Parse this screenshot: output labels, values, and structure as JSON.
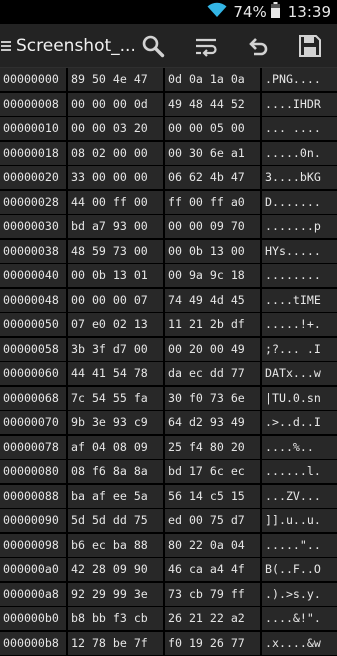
{
  "status_bar": {
    "battery": "74%",
    "time": "13:39",
    "icons": [
      "wifi-icon",
      "battery-icon"
    ]
  },
  "action_bar": {
    "title": "Screenshot_...",
    "actions": [
      "search-icon",
      "wrap-lines-icon",
      "undo-icon",
      "save-icon"
    ]
  },
  "hex_rows": [
    {
      "offset": "00000000",
      "hex1": "89 50 4e 47",
      "hex2": "0d 0a 1a 0a",
      "ascii": ".PNG...."
    },
    {
      "offset": "00000008",
      "hex1": "00 00 00 0d",
      "hex2": "49 48 44 52",
      "ascii": "....IHDR"
    },
    {
      "offset": "00000010",
      "hex1": "00 00 03 20",
      "hex2": "00 00 05 00",
      "ascii": "... ...."
    },
    {
      "offset": "00000018",
      "hex1": "08 02 00 00",
      "hex2": "00 30 6e a1",
      "ascii": ".....0n."
    },
    {
      "offset": "00000020",
      "hex1": "33 00 00 00",
      "hex2": "06 62 4b 47",
      "ascii": "3....bKG"
    },
    {
      "offset": "00000028",
      "hex1": "44 00 ff 00",
      "hex2": "ff 00 ff a0",
      "ascii": "D......."
    },
    {
      "offset": "00000030",
      "hex1": "bd a7 93 00",
      "hex2": "00 00 09 70",
      "ascii": ".......p"
    },
    {
      "offset": "00000038",
      "hex1": "48 59 73 00",
      "hex2": "00 0b 13 00",
      "ascii": "HYs....."
    },
    {
      "offset": "00000040",
      "hex1": "00 0b 13 01",
      "hex2": "00 9a 9c 18",
      "ascii": "........"
    },
    {
      "offset": "00000048",
      "hex1": "00 00 00 07",
      "hex2": "74 49 4d 45",
      "ascii": "....tIME"
    },
    {
      "offset": "00000050",
      "hex1": "07 e0 02 13",
      "hex2": "11 21 2b df",
      "ascii": ".....!+."
    },
    {
      "offset": "00000058",
      "hex1": "3b 3f d7 00",
      "hex2": "00 20 00 49",
      "ascii": ";?... .I"
    },
    {
      "offset": "00000060",
      "hex1": "44 41 54 78",
      "hex2": "da ec dd 77",
      "ascii": "DATx...w"
    },
    {
      "offset": "00000068",
      "hex1": "7c 54 55 fa",
      "hex2": "30 f0 73 6e",
      "ascii": "|TU.0.sn"
    },
    {
      "offset": "00000070",
      "hex1": "9b 3e 93 c9",
      "hex2": "64 d2 93 49",
      "ascii": ".>..d..I"
    },
    {
      "offset": "00000078",
      "hex1": "af 04 08 09",
      "hex2": "25 f4 80 20",
      "ascii": "....%.. "
    },
    {
      "offset": "00000080",
      "hex1": "08 f6 8a 8a",
      "hex2": "bd 17 6c ec",
      "ascii": "......l."
    },
    {
      "offset": "00000088",
      "hex1": "ba af ee 5a",
      "hex2": "56 14 c5 15",
      "ascii": "...ZV..."
    },
    {
      "offset": "00000090",
      "hex1": "5d 5d dd 75",
      "hex2": "ed 00 75 d7",
      "ascii": "]].u..u."
    },
    {
      "offset": "00000098",
      "hex1": "b6 ec ba 88",
      "hex2": "80 22 0a 04",
      "ascii": ".....\".."
    },
    {
      "offset": "000000a0",
      "hex1": "42 28 09 90",
      "hex2": "46 ca a4 4f",
      "ascii": "B(..F..O"
    },
    {
      "offset": "000000a8",
      "hex1": "92 29 99 3e",
      "hex2": "73 cb 79 ff",
      "ascii": ".).>s.y."
    },
    {
      "offset": "000000b0",
      "hex1": "b8 bb f3 cb",
      "hex2": "26 21 22 a2",
      "ascii": "....&!\"."
    },
    {
      "offset": "000000b8",
      "hex1": "12 78 be 7f",
      "hex2": "f0 19 26 77",
      "ascii": ".x....&w"
    }
  ]
}
